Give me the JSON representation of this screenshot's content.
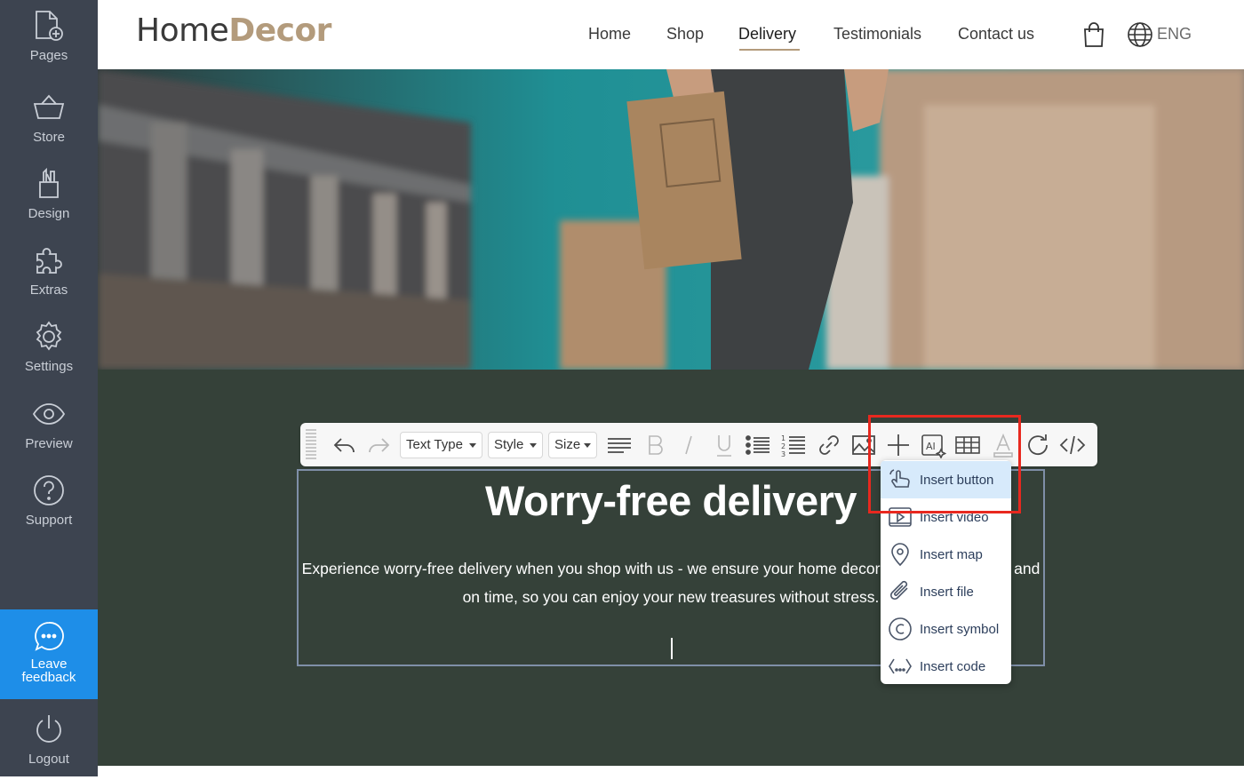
{
  "sidebar": {
    "items": [
      {
        "label": "Pages",
        "icon": "page-add-icon"
      },
      {
        "label": "Store",
        "icon": "basket-icon"
      },
      {
        "label": "Design",
        "icon": "design-tools-icon"
      },
      {
        "label": "Extras",
        "icon": "puzzle-icon"
      },
      {
        "label": "Settings",
        "icon": "gear-icon"
      },
      {
        "label": "Preview",
        "icon": "eye-icon"
      },
      {
        "label": "Support",
        "icon": "help-icon"
      }
    ],
    "feedback": {
      "label": "Leave feedback",
      "icon": "chat-bubble-icon",
      "color": "#1e8ee8"
    },
    "logout": {
      "label": "Logout",
      "icon": "power-icon"
    }
  },
  "header": {
    "logo_part1": "Home",
    "logo_part2": "Decor",
    "nav": [
      "Home",
      "Shop",
      "Delivery",
      "Testimonials",
      "Contact us"
    ],
    "active_nav": "Delivery",
    "language": "ENG"
  },
  "hero": {
    "image": "warehouse worker carrying cardboard boxes"
  },
  "toolbar": {
    "text_type": "Text Type",
    "style": "Style",
    "size": "Size",
    "icons": [
      "undo-icon",
      "redo-icon",
      "align-icon",
      "bold-icon",
      "italic-icon",
      "underline-icon",
      "bullet-list-icon",
      "numbered-list-icon",
      "link-icon",
      "image-icon",
      "plus-icon",
      "ai-icon",
      "table-icon",
      "font-color-icon",
      "refresh-icon",
      "code-icon"
    ]
  },
  "content": {
    "heading": "Worry-free delivery",
    "paragraph": "Experience worry-free delivery when you shop with us - we ensure your home decor items arrive safely and on time, so you can enjoy your new treasures without stress."
  },
  "insert_menu": {
    "items": [
      {
        "label": "Insert button",
        "icon": "hand-pointer-icon",
        "highlighted": true
      },
      {
        "label": "Insert video",
        "icon": "video-icon"
      },
      {
        "label": "Insert map",
        "icon": "map-pin-icon"
      },
      {
        "label": "Insert file",
        "icon": "paperclip-icon"
      },
      {
        "label": "Insert symbol",
        "icon": "copyright-icon"
      },
      {
        "label": "Insert code",
        "icon": "code-brackets-icon"
      }
    ]
  },
  "colors": {
    "sidebar": "#3d4450",
    "accent": "#b39b7c",
    "section": "#354139",
    "highlight": "#e8281f"
  }
}
